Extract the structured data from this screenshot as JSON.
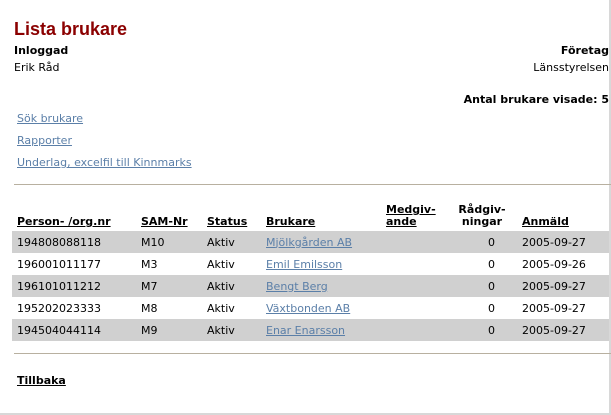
{
  "page": {
    "title": "Lista brukare",
    "inloggad_label": "Inloggad",
    "inloggad_value": "Erik Råd",
    "foretag_label": "Företag",
    "foretag_value": "Länsstyrelsen",
    "count_text": "Antal brukare visade: 5"
  },
  "links": {
    "sok": "Sök brukare",
    "rapporter": "Rapporter",
    "underlag": "Underlag, excelfil till Kinnmarks"
  },
  "table": {
    "headers": {
      "person": "Person- /org.nr",
      "sam": "SAM-Nr",
      "status": "Status",
      "brukare": "Brukare",
      "medgiv_1": "Medgiv-",
      "medgiv_2": "ande",
      "radgiv_1": "Rådgiv-",
      "radgiv_2": "ningar",
      "anmald": "Anmäld"
    },
    "rows": [
      {
        "person": "194808088118",
        "sam": "M10",
        "status": "Aktiv",
        "brukare": "Mjölkgården AB",
        "medgivande": "",
        "radgivningar": "0",
        "anmald": "2005-09-27"
      },
      {
        "person": "196001011177",
        "sam": "M3",
        "status": "Aktiv",
        "brukare": "Emil Emilsson",
        "medgivande": "",
        "radgivningar": "0",
        "anmald": "2005-09-26"
      },
      {
        "person": "196101011212",
        "sam": "M7",
        "status": "Aktiv",
        "brukare": "Bengt Berg",
        "medgivande": "",
        "radgivningar": "0",
        "anmald": "2005-09-27"
      },
      {
        "person": "195202023333",
        "sam": "M8",
        "status": "Aktiv",
        "brukare": "Växtbonden AB",
        "medgivande": "",
        "radgivningar": "0",
        "anmald": "2005-09-27"
      },
      {
        "person": "194504044114",
        "sam": "M9",
        "status": "Aktiv",
        "brukare": "Enar Enarsson",
        "medgivande": "",
        "radgivningar": "0",
        "anmald": "2005-09-27"
      }
    ]
  },
  "footer": {
    "back": "Tillbaka"
  },
  "colors": {
    "title": "#8b0000",
    "link": "#5b7fa8",
    "row_shade": "#d0d0d0"
  }
}
